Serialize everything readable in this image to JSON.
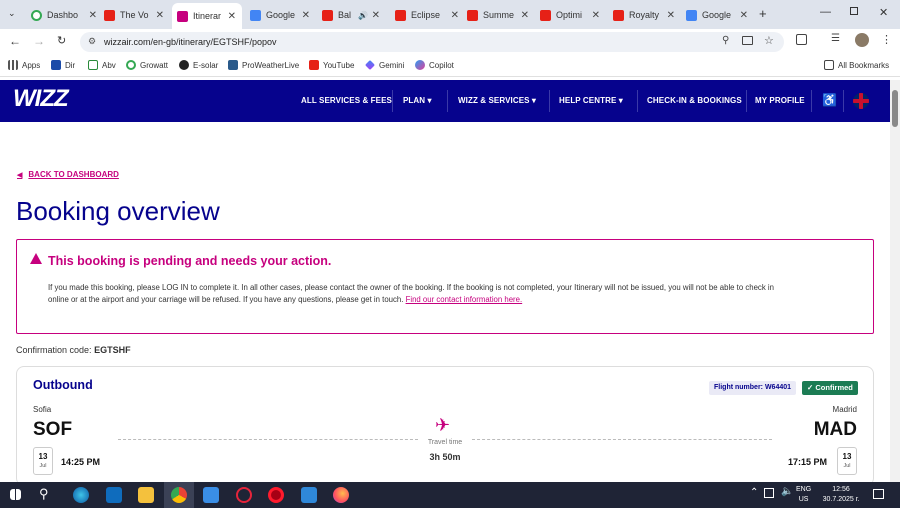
{
  "browser": {
    "tabs": [
      {
        "title": "Dashbo",
        "fav": "g"
      },
      {
        "title": "The Vo",
        "fav": "yt"
      },
      {
        "title": "Itinerar",
        "fav": "wz"
      },
      {
        "title": "Google",
        "fav": "gt"
      },
      {
        "title": "Bal",
        "fav": "yt"
      },
      {
        "title": "Eclipse",
        "fav": "yt"
      },
      {
        "title": "Summe",
        "fav": "yt"
      },
      {
        "title": "Optimi",
        "fav": "yt"
      },
      {
        "title": "Royalty",
        "fav": "yt"
      },
      {
        "title": "Google",
        "fav": "gt"
      }
    ],
    "url": "wizzair.com/en-gb/itinerary/EGTSHF/popov",
    "bookmarks": [
      "Apps",
      "Dir",
      "Abv",
      "Growatt",
      "E-solar",
      "ProWeatherLive",
      "YouTube",
      "Gemini",
      "Copilot"
    ],
    "all_bookmarks": "All Bookmarks"
  },
  "site": {
    "logo": "WIZZ",
    "nav": [
      "ALL SERVICES & FEES",
      "PLAN",
      "WIZZ & SERVICES",
      "HELP CENTRE",
      "CHECK-IN & BOOKINGS",
      "MY PROFILE"
    ]
  },
  "page": {
    "back": "BACK TO DASHBOARD",
    "title": "Booking overview",
    "alert_title": "This booking is pending and needs your action.",
    "alert_body_1": "If you made this booking, please LOG IN to complete it. In all other cases, please contact the owner of the booking. If the booking is not completed, your Itinerary will not be issued, you will not be able to check in",
    "alert_body_2": "online or at the airport and your carriage will be refused. If you have any questions, please get in touch.",
    "alert_link": "Find our contact information here.",
    "conf_label": "Confirmation code:",
    "conf_code": "EGTSHF"
  },
  "flight": {
    "heading": "Outbound",
    "flight_number": "Flight number: W64401",
    "status": "Confirmed",
    "from_city": "Sofia",
    "from_code": "SOF",
    "to_city": "Madrid",
    "to_code": "MAD",
    "travel_label": "Travel time",
    "travel_time": "3h 50m",
    "dep_day": "13",
    "dep_month": "Jul",
    "dep_time": "14:25 PM",
    "arr_day": "13",
    "arr_month": "Jul",
    "arr_time": "17:15 PM"
  },
  "taskbar": {
    "lang1": "ENG",
    "lang2": "US",
    "time": "12:56",
    "date": "30.7.2025 г."
  },
  "colors": {
    "brand": "#06038d",
    "accent": "#c6007e",
    "confirmed": "#1c7c54"
  }
}
